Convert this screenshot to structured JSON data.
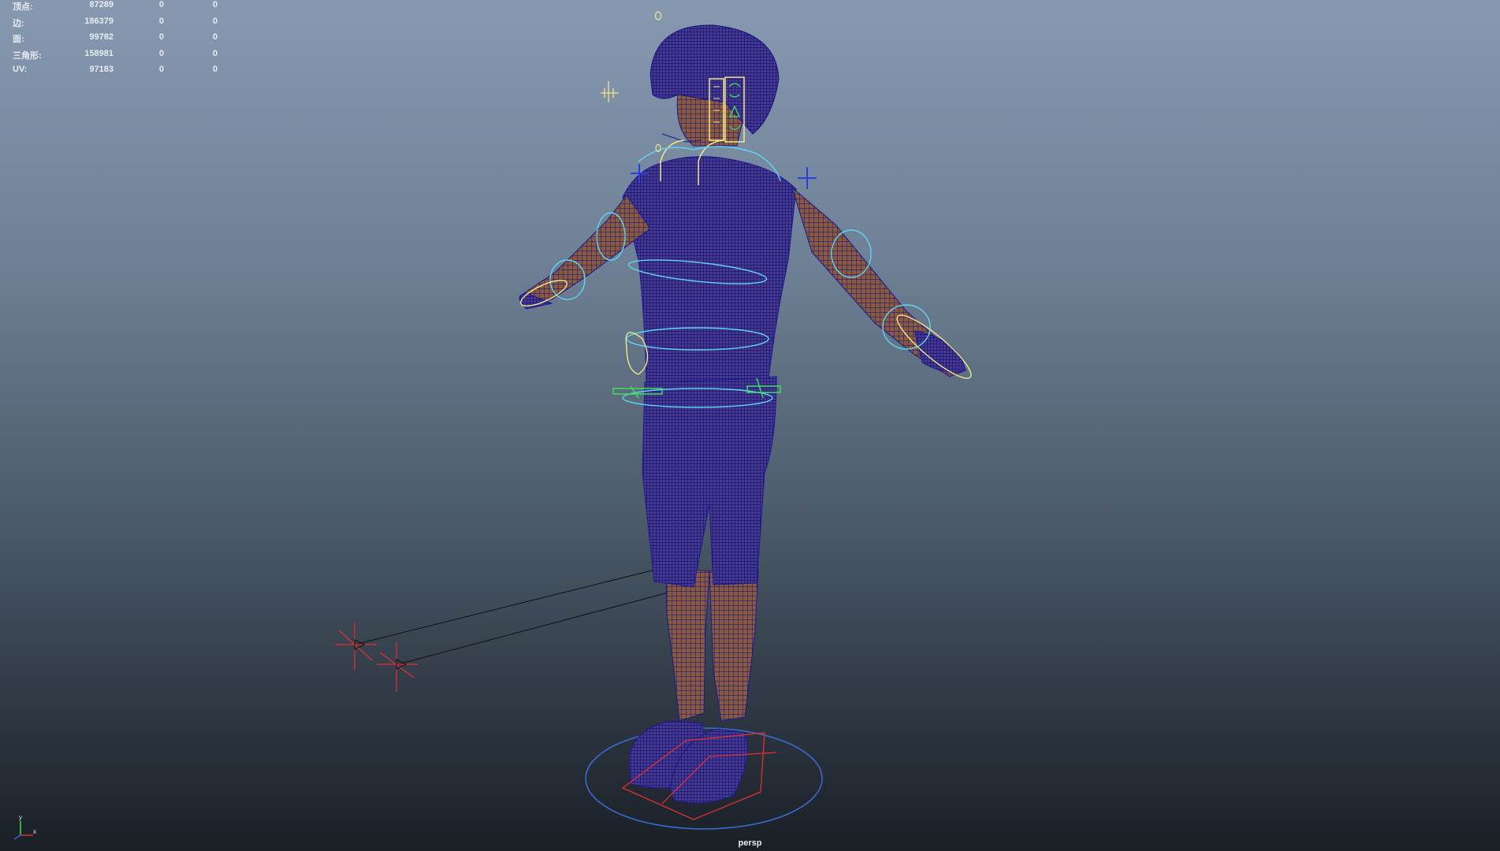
{
  "hud": {
    "rows": [
      {
        "label": "顶点:",
        "value": "87289",
        "sel1": "0",
        "sel2": "0"
      },
      {
        "label": "边:",
        "value": "186379",
        "sel1": "0",
        "sel2": "0"
      },
      {
        "label": "面:",
        "value": "99782",
        "sel1": "0",
        "sel2": "0"
      },
      {
        "label": "三角形:",
        "value": "158981",
        "sel1": "0",
        "sel2": "0"
      },
      {
        "label": "UV:",
        "value": "97183",
        "sel1": "0",
        "sel2": "0"
      }
    ]
  },
  "viewport": {
    "camera": "persp",
    "axis_labels": {
      "y": "y",
      "x": "x"
    }
  },
  "colors": {
    "wire_blue": "#1a1a8c",
    "skin": "#8a5a3a",
    "control_cyan": "#5fd6f2",
    "control_yellow": "#f2e68a",
    "control_green": "#3ce05a",
    "control_red": "#e03030"
  }
}
